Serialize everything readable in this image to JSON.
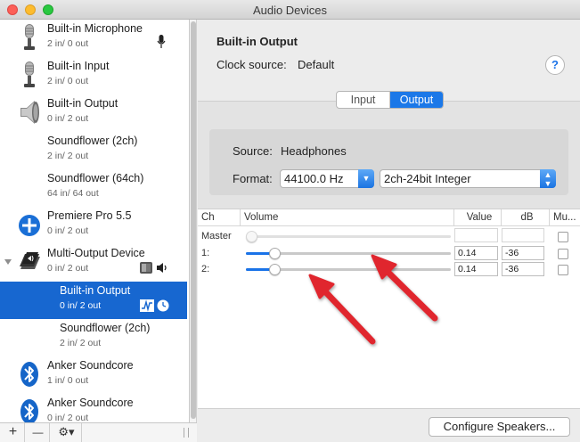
{
  "window": {
    "title": "Audio Devices"
  },
  "sidebar": {
    "devices": [
      {
        "name": "Built-in Microphone",
        "channels": "2 in/ 0 out",
        "icon": "microphone-icon"
      },
      {
        "name": "Built-in Input",
        "channels": "2 in/ 0 out",
        "icon": "microphone-icon"
      },
      {
        "name": "Built-in Output",
        "channels": "0 in/ 2 out",
        "icon": "speaker-icon"
      },
      {
        "name": "Soundflower (2ch)",
        "channels": "2 in/ 2 out",
        "icon": ""
      },
      {
        "name": "Soundflower (64ch)",
        "channels": "64 in/ 64 out",
        "icon": ""
      },
      {
        "name": "Premiere Pro 5.5",
        "channels": "0 in/ 2 out",
        "icon": "plus-circle-icon"
      },
      {
        "name": "Multi-Output Device",
        "channels": "0 in/ 2 out",
        "icon": "multi-output-icon"
      },
      {
        "name": "Built-in Output",
        "channels": "0 in/ 2 out",
        "icon": "",
        "selected": true
      },
      {
        "name": "Soundflower (2ch)",
        "channels": "2 in/ 2 out",
        "icon": ""
      },
      {
        "name": "Anker Soundcore",
        "channels": "1 in/ 0 out",
        "icon": "bluetooth-icon"
      },
      {
        "name": "Anker Soundcore",
        "channels": "0 in/ 2 out",
        "icon": "bluetooth-icon"
      }
    ],
    "bottom": {
      "add": "+",
      "remove": "—",
      "gear": "⚙▾"
    }
  },
  "detail": {
    "title": "Built-in Output",
    "clock_label": "Clock source:",
    "clock_value": "Default",
    "help": "?",
    "tabs": [
      {
        "label": "Input",
        "active": false
      },
      {
        "label": "Output",
        "active": true
      }
    ],
    "source_label": "Source:",
    "source_value": "Headphones",
    "format_label": "Format:",
    "format_rate": "44100.0 Hz",
    "format_bits": "2ch-24bit Integer"
  },
  "table": {
    "headers": {
      "ch": "Ch",
      "volume": "Volume",
      "value": "Value",
      "db": "dB",
      "mute": "Mu..."
    },
    "rows": [
      {
        "ch": "Master",
        "value": "",
        "db": "",
        "level": 0,
        "enabled": false
      },
      {
        "ch": "1:",
        "value": "0.14",
        "db": "-36",
        "level": 0.14,
        "enabled": true
      },
      {
        "ch": "2:",
        "value": "0.14",
        "db": "-36",
        "level": 0.14,
        "enabled": true
      }
    ]
  },
  "footer": {
    "configure": "Configure Speakers..."
  },
  "colors": {
    "accent": "#1a73e8",
    "selection": "#1767d0",
    "arrow": "#e0262e"
  }
}
